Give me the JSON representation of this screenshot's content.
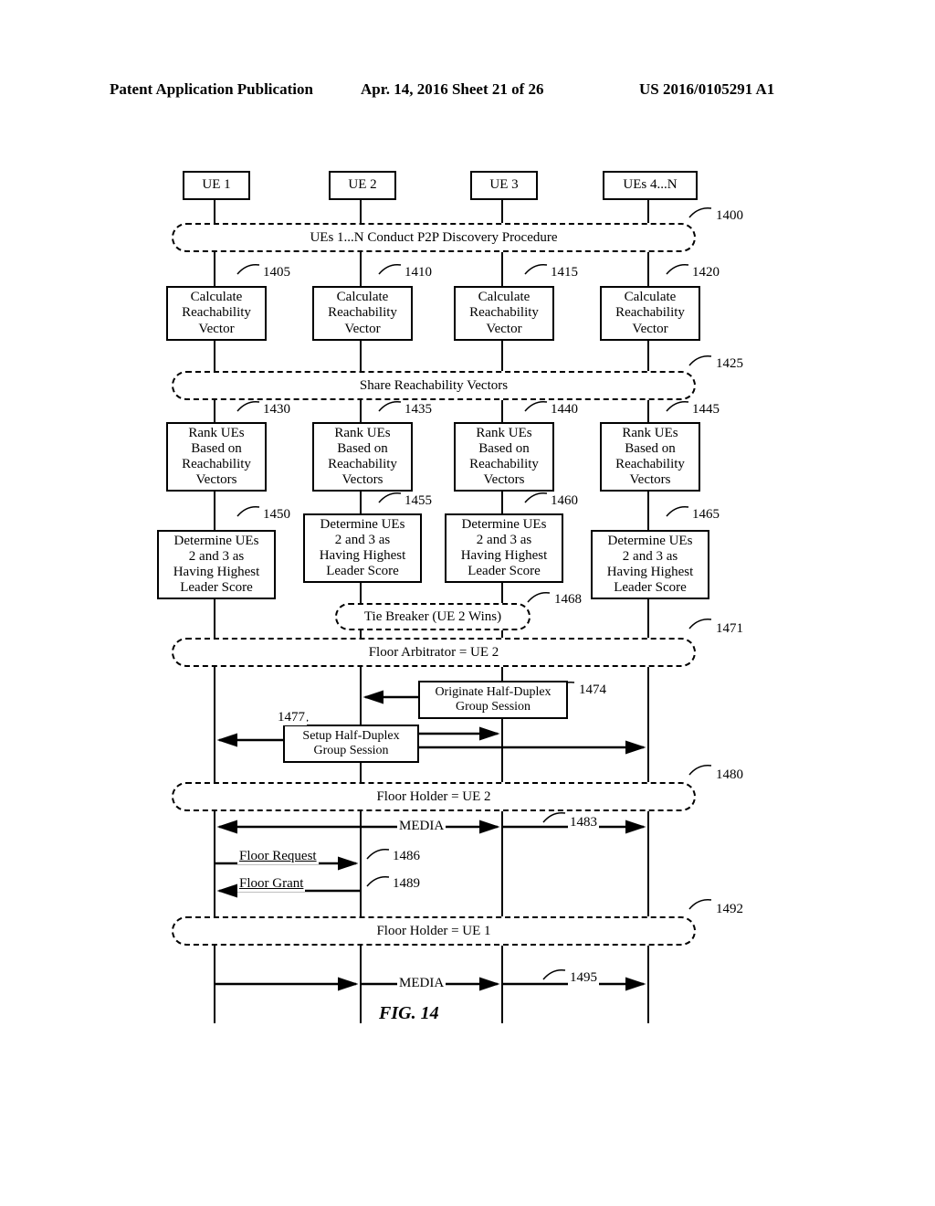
{
  "header": {
    "left": "Patent Application Publication",
    "center": "Apr. 14, 2016  Sheet 21 of 26",
    "right": "US 2016/0105291 A1"
  },
  "lanes": {
    "ue1": "UE 1",
    "ue2": "UE 2",
    "ue3": "UE 3",
    "ue4n": "UEs 4...N"
  },
  "bubbles": {
    "discovery": "UEs 1...N Conduct P2P Discovery Procedure",
    "share": "Share Reachability Vectors",
    "tie": "Tie Breaker (UE 2 Wins)",
    "arb": "Floor Arbitrator = UE 2",
    "fh2": "Floor Holder = UE 2",
    "fh1": "Floor Holder = UE 1"
  },
  "steps": {
    "calc1": "Calculate\nReachability\nVector",
    "calc2": "Calculate\nReachability\nVector",
    "calc3": "Calculate\nReachability\nVector",
    "calc4": "Calculate\nReachability\nVector",
    "rank1": "Rank UEs\nBased on\nReachability\nVectors",
    "rank2": "Rank UEs\nBased on\nReachability\nVectors",
    "rank3": "Rank UEs\nBased on\nReachability\nVectors",
    "rank4": "Rank UEs\nBased on\nReachability\nVectors",
    "det1": "Determine UEs\n2 and 3 as\nHaving Highest\nLeader Score",
    "det2": "Determine UEs\n2 and 3 as\nHaving Highest\nLeader Score",
    "det3": "Determine UEs\n2 and 3 as\nHaving Highest\nLeader Score",
    "det4": "Determine UEs\n2 and 3 as\nHaving Highest\nLeader Score",
    "orig": "Originate Half-Duplex\nGroup Session",
    "setup": "Setup Half-Duplex\nGroup Session"
  },
  "refs": {
    "r1400": "1400",
    "r1405": "1405",
    "r1410": "1410",
    "r1415": "1415",
    "r1420": "1420",
    "r1425": "1425",
    "r1430": "1430",
    "r1435": "1435",
    "r1440": "1440",
    "r1445": "1445",
    "r1450": "1450",
    "r1455": "1455",
    "r1460": "1460",
    "r1465": "1465",
    "r1468": "1468",
    "r1471": "1471",
    "r1474": "1474",
    "r1477": "1477",
    "r1480": "1480",
    "r1483": "1483",
    "r1486": "1486",
    "r1489": "1489",
    "r1492": "1492",
    "r1495": "1495"
  },
  "labels": {
    "media": "MEDIA",
    "floorReq": "Floor Request",
    "floorGrant": "Floor Grant"
  },
  "figure": "FIG. 14"
}
